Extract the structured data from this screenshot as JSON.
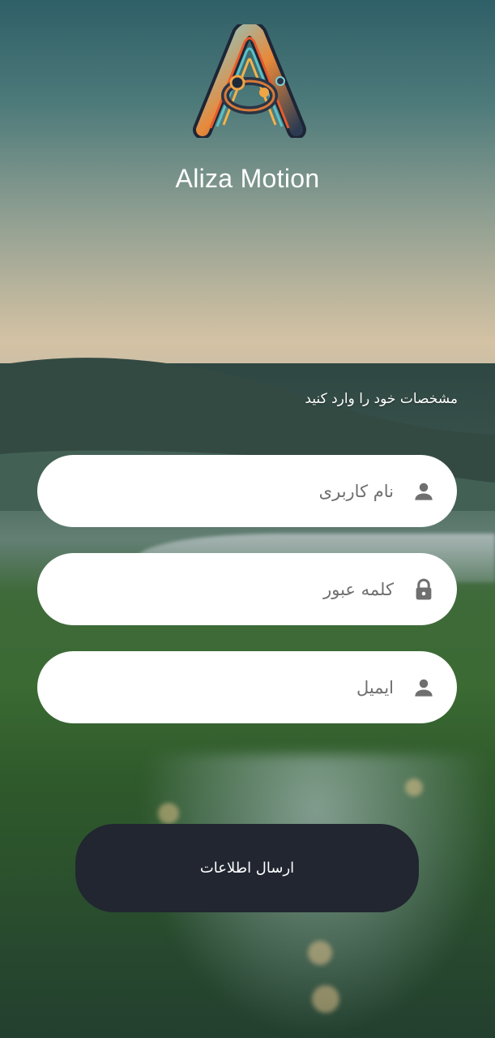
{
  "app": {
    "title": "Aliza Motion",
    "logo_icon": "aliza-motion-logo-icon"
  },
  "form": {
    "prompt": "مشخصات خود را وارد کنید",
    "fields": [
      {
        "name": "username",
        "placeholder": "نام کاربری",
        "value": "",
        "icon": "person-icon"
      },
      {
        "name": "password",
        "placeholder": "کلمه عبور",
        "value": "",
        "icon": "lock-icon"
      },
      {
        "name": "email",
        "placeholder": "ایمیل",
        "value": "",
        "icon": "person-icon"
      }
    ],
    "submit_label": "ارسال اطلاعات"
  },
  "colors": {
    "button_bg": "#212631",
    "field_bg": "#ffffff",
    "icon": "#6f6f6f",
    "text_light": "#ffffff"
  }
}
